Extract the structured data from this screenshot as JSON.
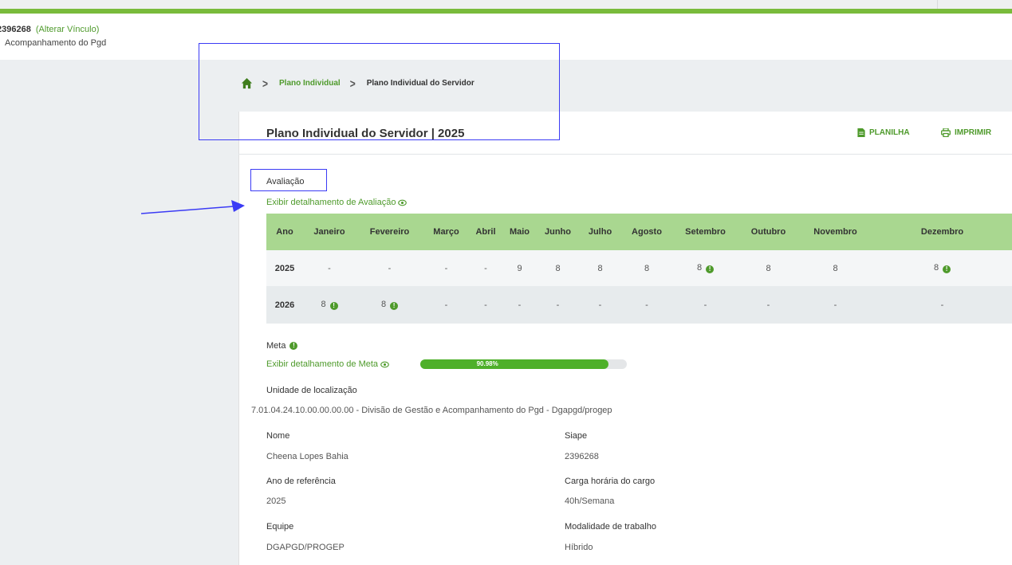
{
  "header": {
    "user_id": "2396268",
    "change_link": "(Alterar Vínculo)",
    "unit": "Acompanhamento do Pgd"
  },
  "breadcrumb": {
    "home_icon": "home-icon",
    "item1": "Plano Individual",
    "item2": "Plano Individual do Servidor"
  },
  "page": {
    "title": "Plano Individual do Servidor | 2025",
    "spreadsheet_label": "PLANILHA",
    "print_label": "IMPRIMIR"
  },
  "evaluation": {
    "section_label": "Avaliação",
    "detail_link": "Exibir detalhamento de Avaliação",
    "columns": [
      "Ano",
      "Janeiro",
      "Fevereiro",
      "Março",
      "Abril",
      "Maio",
      "Junho",
      "Julho",
      "Agosto",
      "Setembro",
      "Outubro",
      "Novembro",
      "Dezembro"
    ],
    "rows": [
      {
        "year": "2025",
        "values": [
          "-",
          "-",
          "-",
          "-",
          "9",
          "8",
          "8",
          "8",
          "8",
          "8",
          "8",
          "8"
        ],
        "info": [
          false,
          false,
          false,
          false,
          false,
          false,
          false,
          false,
          true,
          false,
          false,
          true
        ]
      },
      {
        "year": "2026",
        "values": [
          "8",
          "8",
          "-",
          "-",
          "-",
          "-",
          "-",
          "-",
          "-",
          "-",
          "-",
          "-"
        ],
        "info": [
          true,
          true,
          false,
          false,
          false,
          false,
          false,
          false,
          false,
          false,
          false,
          false
        ]
      }
    ]
  },
  "goal": {
    "section_label": "Meta",
    "detail_link": "Exibir detalhamento de Meta",
    "progress_label": "90.98%",
    "progress_value": 90.98
  },
  "location": {
    "label": "Unidade de localização",
    "value": "7.01.04.24.10.00.00.00.00 - Divisão de Gestão e Acompanhamento do Pgd - Dgapgd/progep"
  },
  "details": {
    "nome_label": "Nome",
    "nome_value": "Cheena Lopes Bahia",
    "siape_label": "Siape",
    "siape_value": "2396268",
    "ano_label": "Ano de referência",
    "ano_value": "2025",
    "carga_label": "Carga horária do cargo",
    "carga_value": "40h/Semana",
    "equipe_label": "Equipe",
    "equipe_value": "DGAPGD/PROGEP",
    "modalidade_label": "Modalidade de trabalho",
    "modalidade_value": "Híbrido"
  },
  "colors": {
    "accent_green": "#4e9a2b",
    "table_header": "#a9d790",
    "annotation_blue": "#3b3bf5"
  }
}
